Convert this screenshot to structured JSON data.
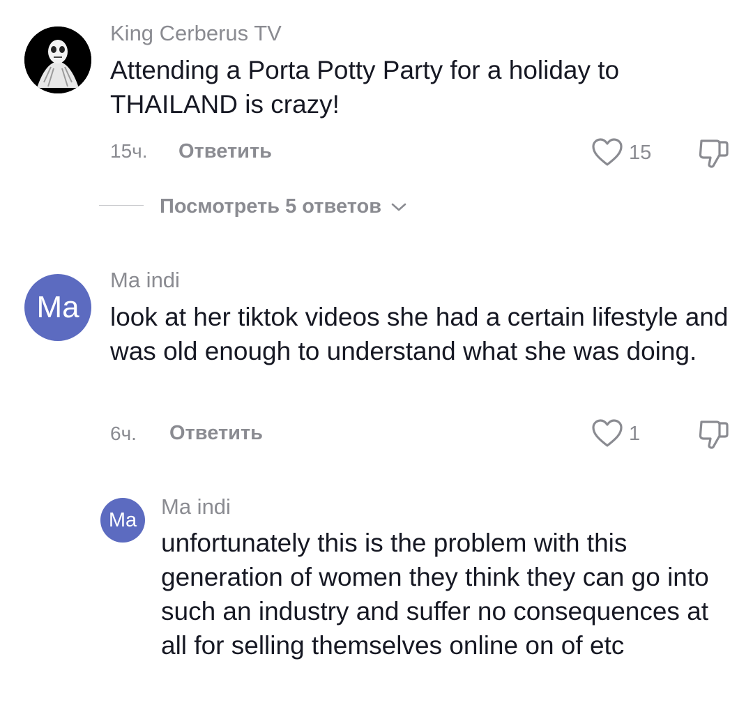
{
  "comments": [
    {
      "username": "King Cerberus TV",
      "text": "Attending a Porta Potty Party for a holiday to THAILAND is crazy!",
      "time": "15ч.",
      "reply_label": "Ответить",
      "likes": "15",
      "view_replies": "Посмотреть 5 ответов"
    },
    {
      "avatar_text": "Ma",
      "username": "Ma indi",
      "text": "look at her tiktok videos she had a certain lifestyle and was old enough to understand what she was doing.",
      "time": "6ч.",
      "reply_label": "Ответить",
      "likes": "1"
    },
    {
      "avatar_text": "Ma",
      "username": "Ma indi",
      "text": "unfortunately this is the problem with this generation of women they think they can go into such an industry and suffer no consequences at all for selling themselves online on of etc"
    }
  ],
  "colors": {
    "avatar_bg": "#5c6bc0",
    "secondary_text": "#8a8b91",
    "primary_text": "#161823"
  },
  "icons": [
    "heart-outline-icon",
    "dislike-icon",
    "chevron-down-icon"
  ]
}
